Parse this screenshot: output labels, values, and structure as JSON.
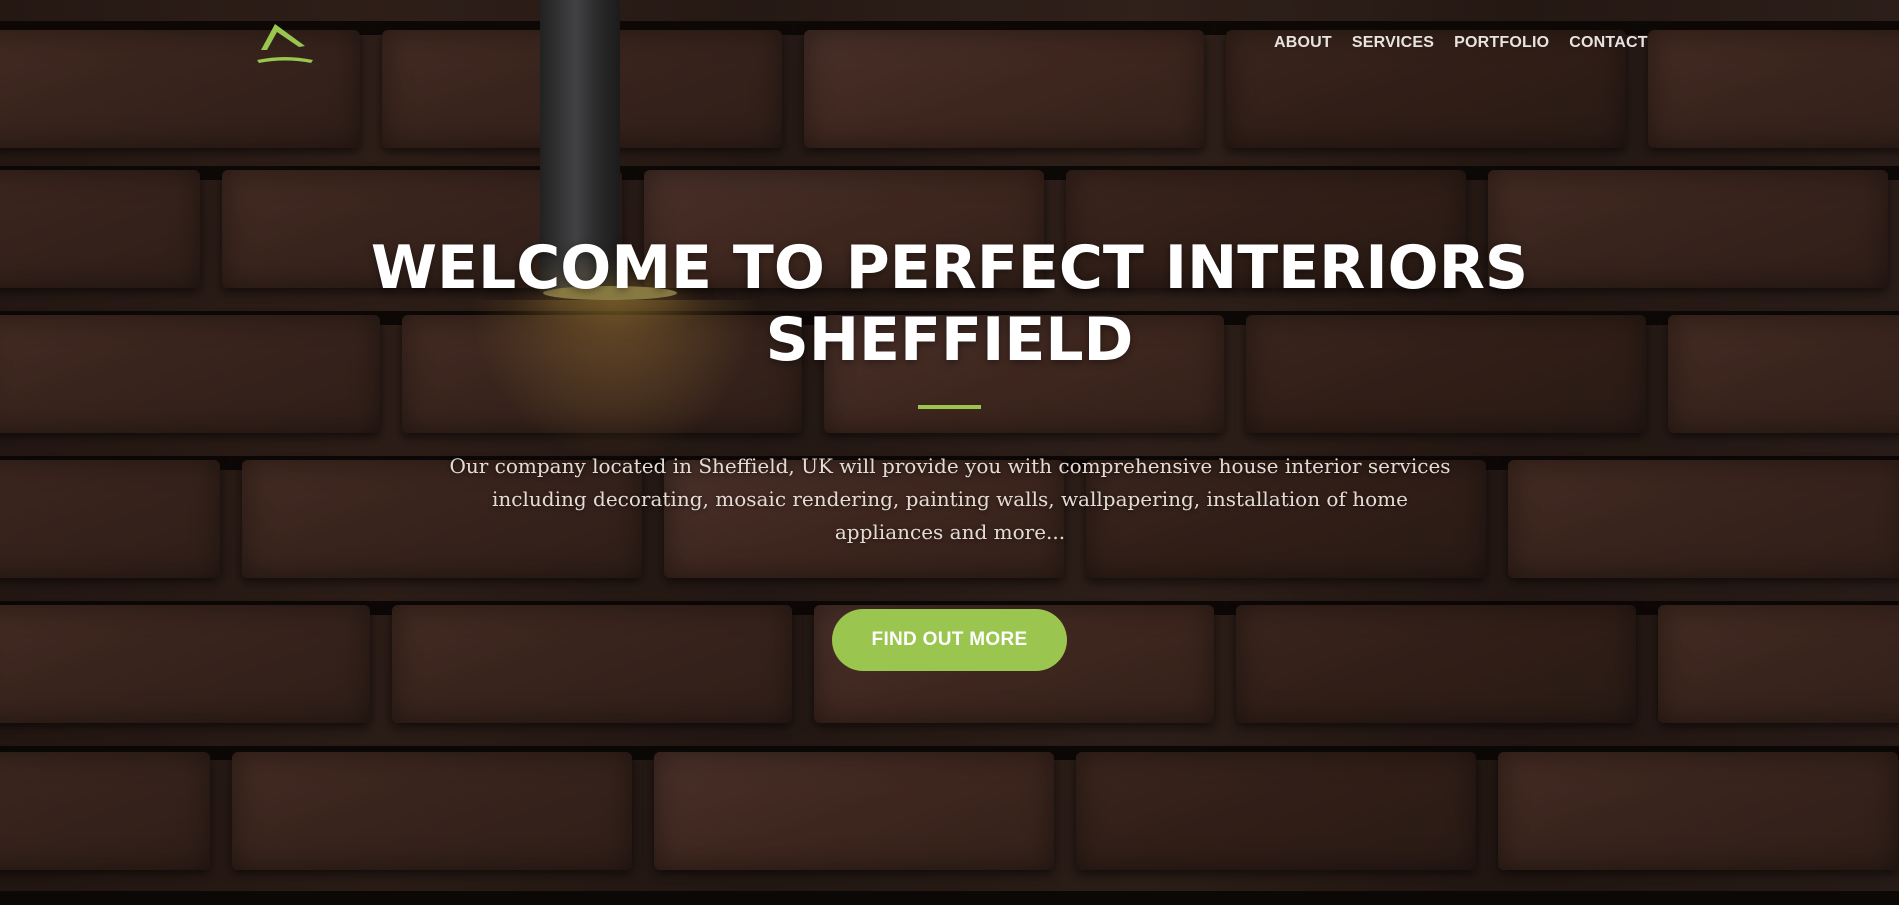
{
  "nav": {
    "items": [
      {
        "label": "ABOUT"
      },
      {
        "label": "SERVICES"
      },
      {
        "label": "PORTFOLIO"
      },
      {
        "label": "CONTACT"
      }
    ]
  },
  "hero": {
    "title_line1": "WELCOME TO PERFECT INTERIORS",
    "title_line2": "SHEFFIELD",
    "description": "Our company located in Sheffield, UK will provide you with comprehensive house interior services including decorating, mosaic rendering, painting walls, wallpapering, installation of home appliances and more...",
    "cta_label": "FIND OUT MORE"
  },
  "colors": {
    "accent": "#9ac54e",
    "text": "#ffffff"
  },
  "icons": {
    "logo": "house-roof-logo-icon"
  }
}
